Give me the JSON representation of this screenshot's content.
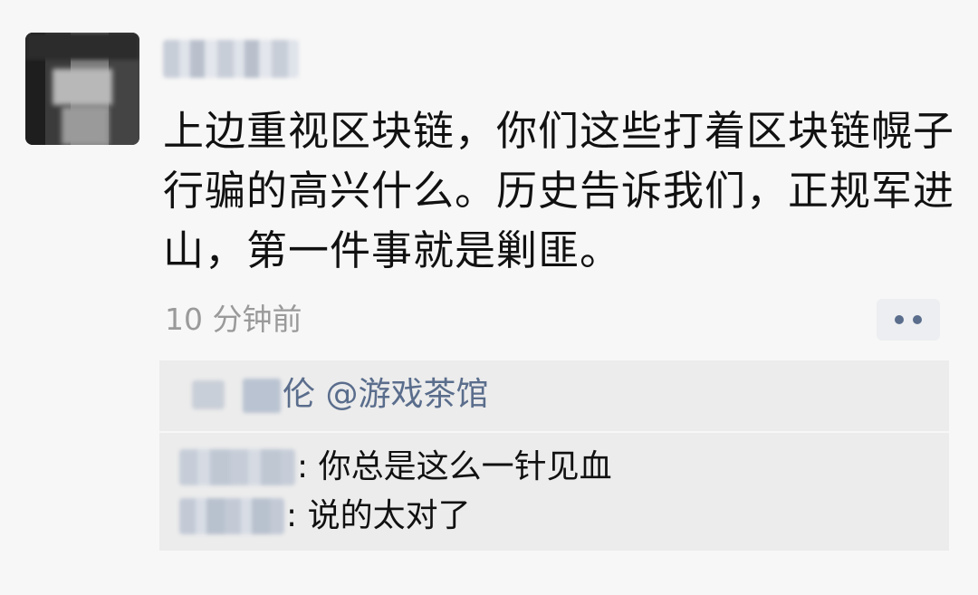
{
  "post": {
    "author_avatar": "avatar-blurred",
    "author_name": "",
    "text": "上边重视区块链，你们这些打着区块链幌子行骗的高兴什么。历史告诉我们，正规军进山，第一件事就是剿匪。",
    "time": "10 分钟前",
    "more_icon": "more-dots-icon"
  },
  "likes": {
    "icon": "heart-icon",
    "names_text": "伦 @游戏茶馆"
  },
  "comments": [
    {
      "author": "",
      "separator": ": ",
      "text": "你总是这么一针见血"
    },
    {
      "author": "",
      "separator": ": ",
      "text": "说的太对了"
    }
  ],
  "colors": {
    "background": "#f7f7f7",
    "comment_area": "#ececec",
    "link_blue": "#5a6d8c",
    "time_gray": "#9a9a9a",
    "text": "#111111"
  }
}
